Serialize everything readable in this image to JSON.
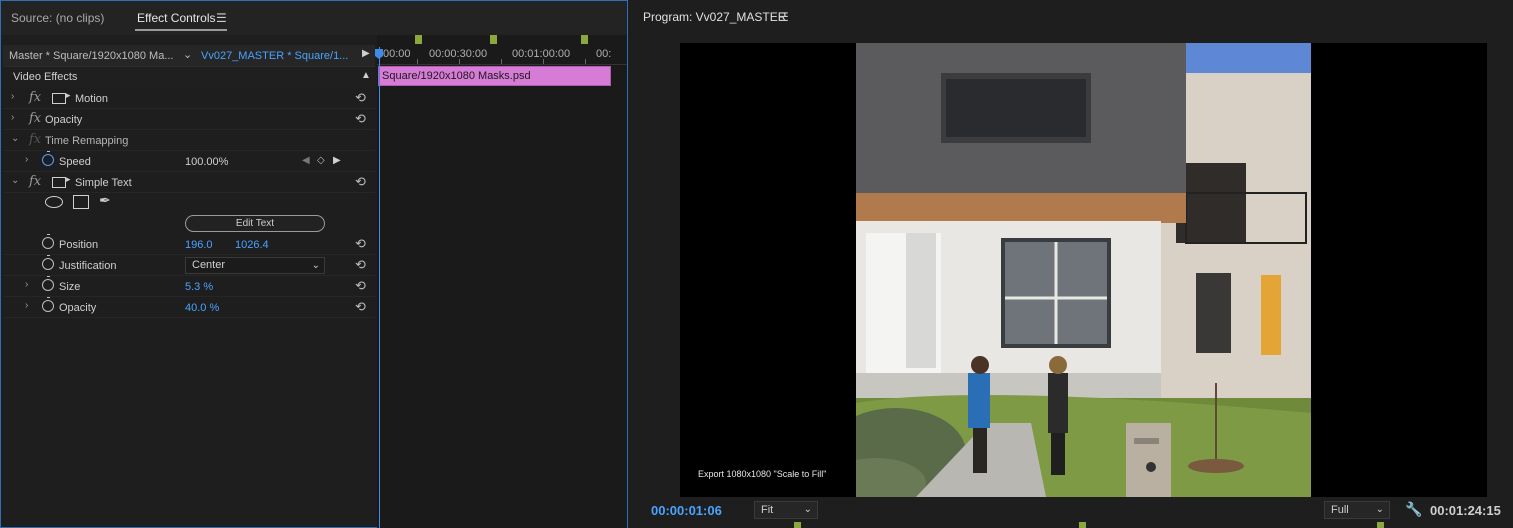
{
  "source_tab": {
    "label": "Source: (no clips)"
  },
  "effect_controls_tab": {
    "label": "Effect Controls",
    "menu_glyph": "☰"
  },
  "ec_header": {
    "source_label": "Master * Square/1920x1080 Ma...",
    "sequence_label": "Vv027_MASTER * Square/1..."
  },
  "video_effects_label": "Video Effects",
  "effects": {
    "motion": {
      "label": "Motion"
    },
    "opacity": {
      "label": "Opacity"
    },
    "time_remapping": {
      "label": "Time Remapping"
    },
    "speed": {
      "label": "Speed",
      "value": "100.00%"
    },
    "simple_text": {
      "label": "Simple Text",
      "edit_text_label": "Edit Text"
    },
    "position": {
      "label": "Position",
      "x": "196.0",
      "y": "1026.4"
    },
    "justification": {
      "label": "Justification",
      "value": "Center"
    },
    "size": {
      "label": "Size",
      "value": "5.3 %"
    },
    "text_opacity": {
      "label": "Opacity",
      "value": "40.0 %"
    }
  },
  "timeline": {
    "timecodes": [
      "00:00",
      "00:00:30:00",
      "00:01:00:00",
      "00:"
    ],
    "clip_label": "Square/1920x1080 Masks.psd"
  },
  "program": {
    "title": "Program: Vv027_MASTER",
    "menu_glyph": "☰",
    "overlay_text": "Export 1080x1080 \"Scale to Fill\"",
    "current_timecode": "00:00:01:06",
    "fit_select": "Fit",
    "resolution_select": "Full",
    "duration_timecode": "00:01:24:15"
  },
  "glyphs": {
    "collapsed": "›",
    "expanded": "⌄",
    "fx": "fx",
    "reset": "⟲",
    "play": "▶",
    "triangle_up": "▲",
    "caret_down": "⌄",
    "kf_prev": "◀",
    "kf_add": "◇",
    "kf_next": "▶",
    "wrench": "🔧",
    "pen": "✒"
  },
  "colors": {
    "accent_blue": "#4aa3ff",
    "clip_pink": "#d67cd6",
    "marker_green": "#8aa83e",
    "panel_bg": "#1e1e1e"
  }
}
